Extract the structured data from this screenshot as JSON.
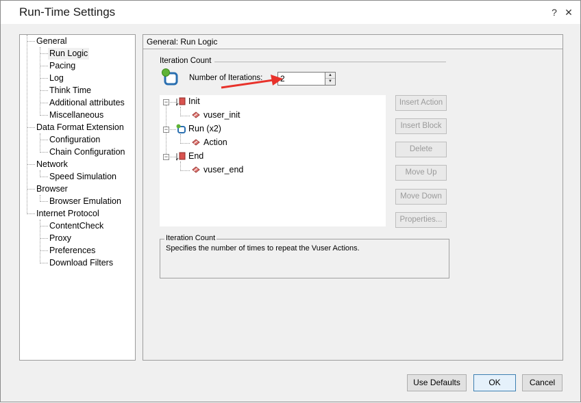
{
  "window": {
    "title": "Run-Time Settings",
    "help_glyph": "?",
    "close_glyph": "✕"
  },
  "nav": {
    "items": [
      {
        "label": "General"
      },
      {
        "label": "Run Logic"
      },
      {
        "label": "Pacing"
      },
      {
        "label": "Log"
      },
      {
        "label": "Think Time"
      },
      {
        "label": "Additional attributes"
      },
      {
        "label": "Miscellaneous"
      },
      {
        "label": "Data Format Extension"
      },
      {
        "label": "Configuration"
      },
      {
        "label": "Chain Configuration"
      },
      {
        "label": "Network"
      },
      {
        "label": "Speed Simulation"
      },
      {
        "label": "Browser"
      },
      {
        "label": "Browser Emulation"
      },
      {
        "label": "Internet Protocol"
      },
      {
        "label": "ContentCheck"
      },
      {
        "label": "Proxy"
      },
      {
        "label": "Preferences"
      },
      {
        "label": "Download Filters"
      }
    ],
    "selected": "Run Logic"
  },
  "pane": {
    "header": "General: Run Logic",
    "iteration_group": "Iteration Count",
    "iterations_label": "Number of Iterations:",
    "iterations_value": "2",
    "tree": {
      "init": "Init",
      "vuser_init": "vuser_init",
      "run": "Run (x2)",
      "action": "Action",
      "end": "End",
      "vuser_end": "vuser_end"
    },
    "buttons": {
      "insert_action": "Insert Action",
      "insert_block": "Insert Block",
      "delete": "Delete",
      "move_up": "Move Up",
      "move_down": "Move Down",
      "properties": "Properties..."
    },
    "description": {
      "title": "Iteration Count",
      "text": "Specifies the number of times to repeat the Vuser Actions."
    }
  },
  "footer": {
    "use_defaults": "Use Defaults",
    "ok": "OK",
    "cancel": "Cancel"
  },
  "colors": {
    "annotation_arrow": "#e8322b",
    "ok_border": "#3c7fb1"
  }
}
